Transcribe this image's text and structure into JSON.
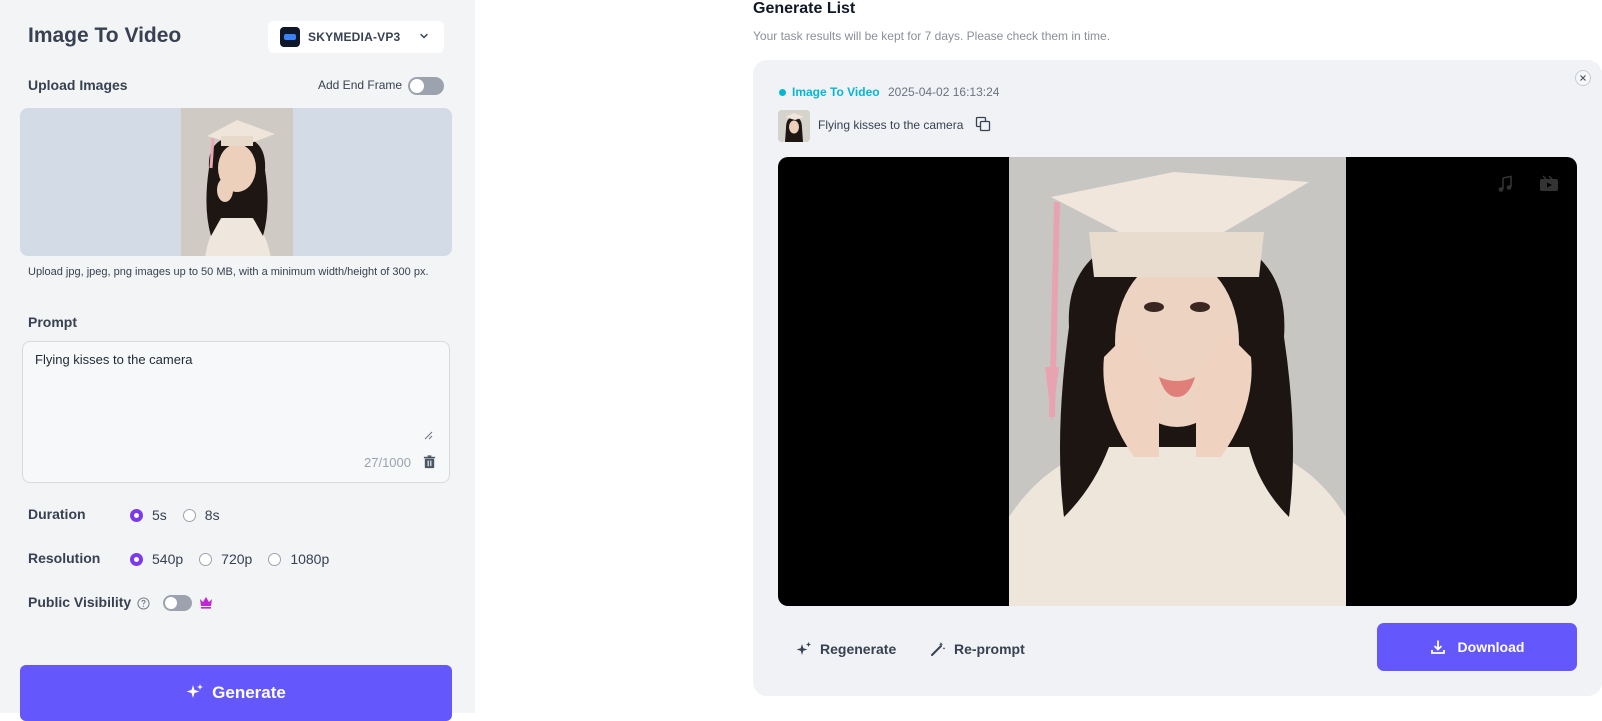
{
  "left_panel": {
    "title": "Image To Video",
    "model": {
      "label": "SKYMEDIA-VP3",
      "icon": "chevron-down-icon"
    },
    "upload": {
      "title": "Upload Images",
      "end_frame_label": "Add End Frame",
      "end_frame_enabled": false,
      "hint": "Upload jpg, jpeg, png images up to 50 MB, with a minimum width/height of 300 px."
    },
    "prompt": {
      "title": "Prompt",
      "value": "Flying kisses to the camera",
      "char_count": "27/1000"
    },
    "duration": {
      "label": "Duration",
      "options": [
        "5s",
        "8s"
      ],
      "selected": "5s"
    },
    "resolution": {
      "label": "Resolution",
      "options": [
        "540p",
        "720p",
        "1080p"
      ],
      "selected": "540p"
    },
    "visibility": {
      "label": "Public Visibility",
      "enabled": false
    },
    "generate_label": "Generate"
  },
  "generate_list": {
    "title": "Generate List",
    "subtitle": "Your task results will be kept for 7 days. Please check them in time.",
    "task": {
      "type": "Image To Video",
      "time": "2025-04-02 16:13:24",
      "prompt": "Flying kisses to the camera",
      "regenerate_label": "Regenerate",
      "reprompt_label": "Re-prompt",
      "download_label": "Download"
    }
  },
  "colors": {
    "accent": "#6457fb",
    "radio_selected": "#7c3aed",
    "status": "#06b6d4",
    "crown": "#c026d3"
  }
}
